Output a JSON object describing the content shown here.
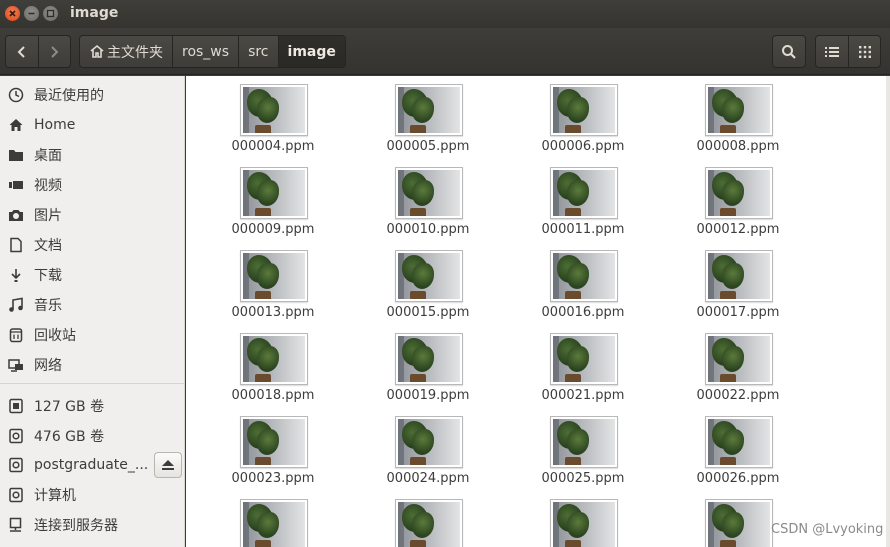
{
  "window": {
    "title": "image"
  },
  "breadcrumbs": [
    {
      "label": "主文件夹",
      "icon": "home-icon"
    },
    {
      "label": "ros_ws"
    },
    {
      "label": "src"
    },
    {
      "label": "image"
    }
  ],
  "sidebar": {
    "places": [
      {
        "label": "最近使用的",
        "icon": "recent-icon"
      },
      {
        "label": "Home",
        "icon": "home-icon"
      },
      {
        "label": "桌面",
        "icon": "folder-icon"
      },
      {
        "label": "视频",
        "icon": "video-icon"
      },
      {
        "label": "图片",
        "icon": "camera-icon"
      },
      {
        "label": "文档",
        "icon": "document-icon"
      },
      {
        "label": "下载",
        "icon": "download-icon"
      },
      {
        "label": "音乐",
        "icon": "music-icon"
      },
      {
        "label": "回收站",
        "icon": "trash-icon"
      },
      {
        "label": "网络",
        "icon": "network-icon"
      }
    ],
    "devices": [
      {
        "label": "127 GB 卷",
        "icon": "drive-icon"
      },
      {
        "label": "476 GB 卷",
        "icon": "drive-icon"
      },
      {
        "label": "postgraduate_...",
        "icon": "drive-icon"
      },
      {
        "label": "计算机",
        "icon": "drive-icon"
      },
      {
        "label": "连接到服务器",
        "icon": "server-icon"
      }
    ]
  },
  "files": [
    "000004.ppm",
    "000005.ppm",
    "000006.ppm",
    "000008.ppm",
    "000009.ppm",
    "000010.ppm",
    "000011.ppm",
    "000012.ppm",
    "000013.ppm",
    "000015.ppm",
    "000016.ppm",
    "000017.ppm",
    "000018.ppm",
    "000019.ppm",
    "000021.ppm",
    "000022.ppm",
    "000023.ppm",
    "000024.ppm",
    "000025.ppm",
    "000026.ppm",
    "",
    "",
    "",
    ""
  ],
  "watermark": "CSDN @Lvyoking"
}
